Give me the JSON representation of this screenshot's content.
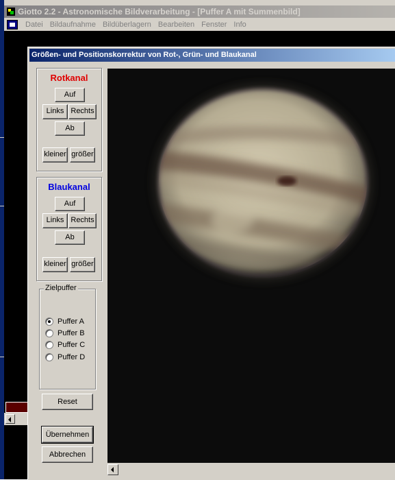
{
  "app": {
    "title": "Giotto 2.2 - Astronomische Bildverarbeitung - [Puffer A mit Summenbild]"
  },
  "menu": {
    "items": [
      "Datei",
      "Bildaufnahme",
      "Bildüberlagern",
      "Bearbeiten",
      "Fenster",
      "Info"
    ]
  },
  "dialog": {
    "title": "Größen- und Positionskorrektur von Rot-, Grün- und Blaukanal",
    "red_channel": {
      "heading": "Rotkanal",
      "color": "#e00000",
      "up": "Auf",
      "left": "Links",
      "right": "Rechts",
      "down": "Ab",
      "smaller": "kleiner",
      "larger": "größer"
    },
    "blue_channel": {
      "heading": "Blaukanal",
      "color": "#0000e0",
      "up": "Auf",
      "left": "Links",
      "right": "Rechts",
      "down": "Ab",
      "smaller": "kleiner",
      "larger": "größer"
    },
    "target_buffer": {
      "label": "Zielpuffer",
      "options": [
        "Puffer A",
        "Puffer B",
        "Puffer C",
        "Puffer D"
      ],
      "selected": "Puffer A"
    },
    "reset_label": "Reset",
    "apply_label": "Übernehmen",
    "cancel_label": "Abbrechen"
  },
  "image": {
    "subject": "planet",
    "background_color": "#0c0c0c"
  }
}
